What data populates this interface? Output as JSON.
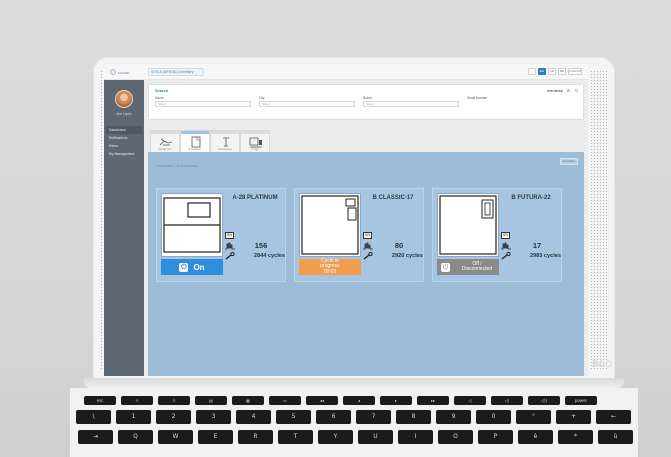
{
  "app": {
    "brand_text": "scican",
    "title": "SITE A (DENTAL) Dentistry",
    "top_actions": [
      "",
      "EN",
      "FR",
      "DE",
      "LOGOUT"
    ]
  },
  "sidebar": {
    "user_name": "Ann Lopez",
    "items": [
      {
        "label": "Dashboard",
        "active": true
      },
      {
        "label": "Notifications"
      },
      {
        "label": "Users"
      },
      {
        "label": "My Management"
      }
    ]
  },
  "filters": {
    "title": "Search",
    "view_select": "Interdental",
    "fields": [
      {
        "label": "Name",
        "placeholder": "Select"
      },
      {
        "label": "City",
        "placeholder": "Select"
      },
      {
        "label": "Brand",
        "placeholder": "Select"
      },
      {
        "label": "Serial Number",
        "placeholder": ""
      }
    ]
  },
  "tabs": [
    {
      "label": "Dental Unit",
      "icon": "dental-chair-icon",
      "active": false
    },
    {
      "label": "Autoclaves",
      "icon": "document-icon",
      "active": true
    },
    {
      "label": "Handpieces",
      "icon": "handpiece-icon",
      "active": false
    },
    {
      "label": "X-Ray",
      "icon": "monitor-icon",
      "active": false
    }
  ],
  "device_area": {
    "breadcrumb": "Dashboard  >  All Autoclaves",
    "button_label": "Autoclave"
  },
  "devices": [
    {
      "name": "A-28 PLATINUM",
      "sn_label": "SN",
      "value": "156",
      "cycles": "2844 cycles",
      "status": "on",
      "status_text": "On",
      "icon": "autoclave-platinum-icon"
    },
    {
      "name": "B CLASSIC-17",
      "sn_label": "SN",
      "value": "80",
      "cycles": "2920 cycles",
      "status": "progress",
      "status_lines": [
        "Cycle in",
        "progress",
        "00:03"
      ],
      "icon": "autoclave-classic-icon"
    },
    {
      "name": "B FUTURA-22",
      "sn_label": "SN",
      "value": "17",
      "cycles": "2983 cycles",
      "status": "off",
      "status_lines": [
        "Off /",
        "Disconnected"
      ],
      "icon": "autoclave-futura-icon"
    }
  ],
  "colors": {
    "accent": "#2f79c4",
    "status_on": "#2e8fdc",
    "status_progress": "#f09d4e",
    "status_off": "#8a8a8a",
    "device_area_bg": "#9cbcd8"
  },
  "keyboard": {
    "fn_row": [
      "esc",
      "☼",
      "☼",
      "▤",
      "▦",
      "▭",
      "◂◂",
      "◂",
      "▸",
      "▸▸",
      "◁",
      "◁)",
      "◁))",
      "power"
    ],
    "number_row": [
      "\\",
      "1",
      "2",
      "3",
      "4",
      "5",
      "6",
      "7",
      "8",
      "9",
      "0",
      "°",
      "+",
      "←"
    ],
    "qwerty_row": [
      "⇥",
      "Q",
      "W",
      "E",
      "R",
      "T",
      "Y",
      "U",
      "I",
      "O",
      "P",
      "è",
      "*",
      "ù"
    ]
  }
}
